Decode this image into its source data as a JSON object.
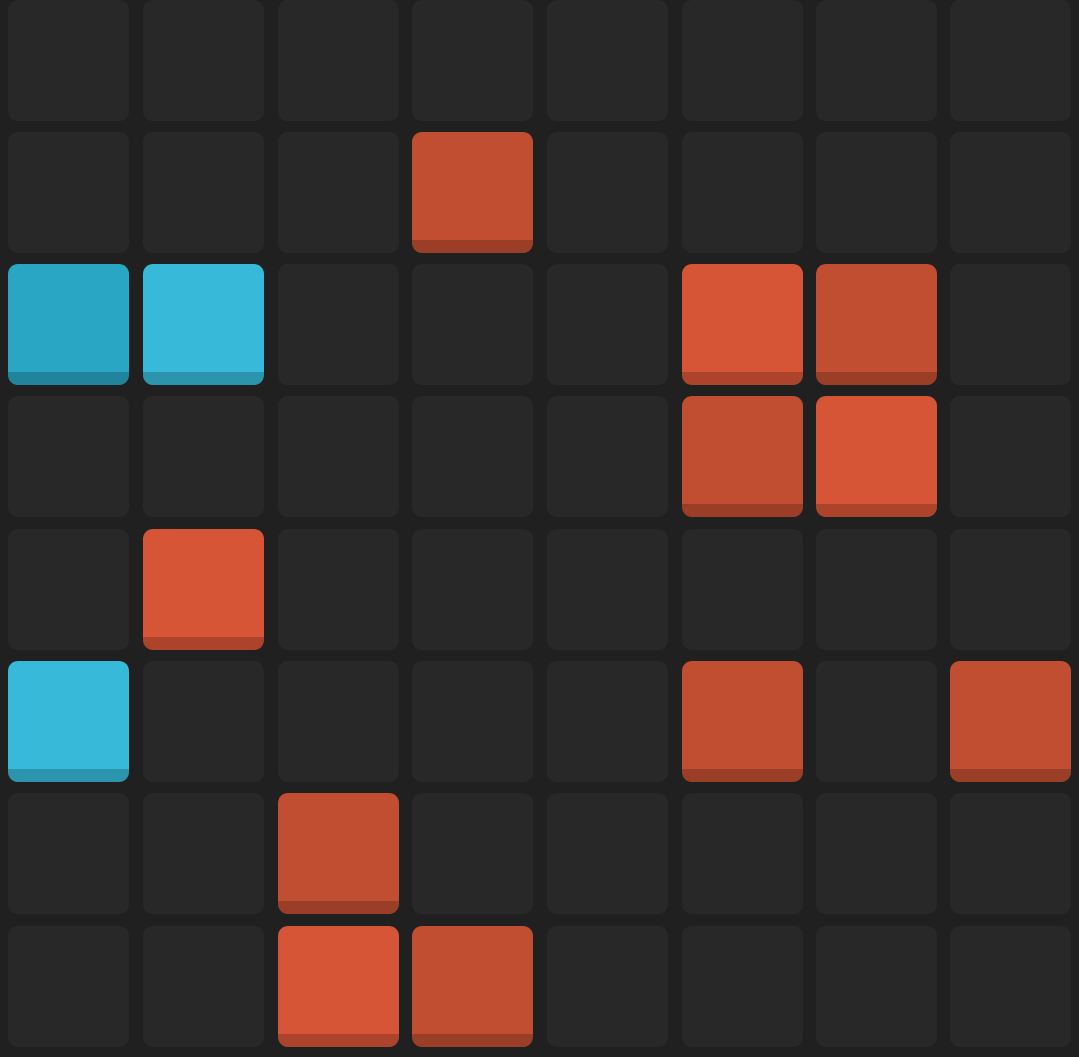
{
  "board": {
    "rows": 8,
    "cols": 8,
    "colors": {
      "background": "#202020",
      "empty": "#282828",
      "orange": "#d65536",
      "red": "#c24e32",
      "cyan": "#37b9d9",
      "teal": "#2aa6c5"
    },
    "grid": [
      [
        "empty",
        "empty",
        "empty",
        "empty",
        "empty",
        "empty",
        "empty",
        "empty"
      ],
      [
        "empty",
        "empty",
        "empty",
        "red",
        "empty",
        "empty",
        "empty",
        "empty"
      ],
      [
        "teal",
        "cyan",
        "empty",
        "empty",
        "empty",
        "orange",
        "red",
        "empty"
      ],
      [
        "empty",
        "empty",
        "empty",
        "empty",
        "empty",
        "red",
        "orange",
        "empty"
      ],
      [
        "empty",
        "orange",
        "empty",
        "empty",
        "empty",
        "empty",
        "empty",
        "empty"
      ],
      [
        "cyan",
        "empty",
        "empty",
        "empty",
        "empty",
        "red",
        "empty",
        "red"
      ],
      [
        "empty",
        "empty",
        "red",
        "empty",
        "empty",
        "empty",
        "empty",
        "empty"
      ],
      [
        "empty",
        "empty",
        "orange",
        "red",
        "empty",
        "empty",
        "empty",
        "empty"
      ]
    ]
  }
}
